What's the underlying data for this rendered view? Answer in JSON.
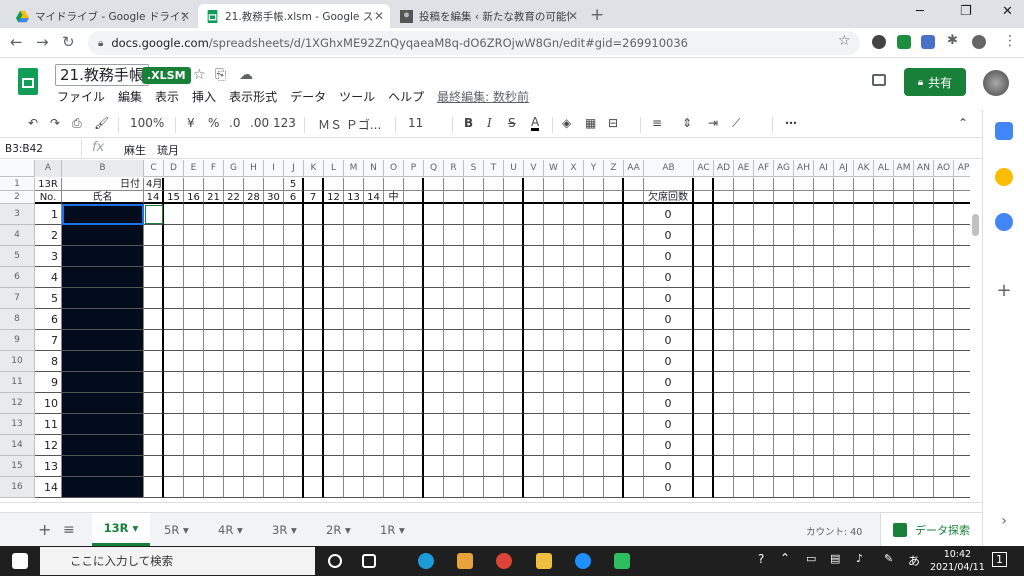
{
  "browser": {
    "tabs": [
      {
        "title": "マイドライブ - Google ドライブ",
        "icon": "drive-icon",
        "active": false
      },
      {
        "title": "21.教務手帳.xlsm - Google スプレ",
        "icon": "sheets-icon",
        "active": true
      },
      {
        "title": "投稿を編集 ‹ 新たな教育の可能性",
        "icon": "wordpress-icon",
        "active": false
      }
    ],
    "new_tab": "+",
    "url_host": "docs.google.com",
    "url_path": "/spreadsheets/d/1XGhxME92ZnQyqaeaM8q-dO6ZROjwW8Gn/edit#gid=269910036"
  },
  "app": {
    "doc_title": "21.教務手帳",
    "file_badge": ".XLSM",
    "menus": [
      "ファイル",
      "編集",
      "表示",
      "挿入",
      "表示形式",
      "データ",
      "ツール",
      "ヘルプ"
    ],
    "last_edit": "最終編集: 数秒前",
    "share_label": "共有",
    "accent": "#188038"
  },
  "toolbar": {
    "zoom": "100%",
    "currency": "¥",
    "percent": "%",
    "dec_less": ".0",
    "dec_more": ".00",
    "format": "123",
    "font": "ＭＳ Ｐゴ...",
    "font_size": "11",
    "bold": "B",
    "italic": "I",
    "strike": "S",
    "text_color": "A",
    "more": "⋯"
  },
  "formula": {
    "name_box": "B3:B42",
    "fx": "fx",
    "value": "麻生　琉月"
  },
  "sheet": {
    "columns": [
      "A",
      "B",
      "C",
      "D",
      "E",
      "F",
      "G",
      "H",
      "I",
      "J",
      "K",
      "L",
      "M",
      "N",
      "O",
      "P",
      "Q",
      "R",
      "S",
      "T",
      "U",
      "V",
      "W",
      "X",
      "Y",
      "Z",
      "AA",
      "AB",
      "AC",
      "AD",
      "AE",
      "AF",
      "AG",
      "AH",
      "AI",
      "AJ",
      "AK",
      "AL",
      "AM",
      "AN",
      "AO",
      "AP"
    ],
    "row_numbers": [
      "1",
      "2",
      "3",
      "4",
      "5",
      "6",
      "7",
      "8",
      "9",
      "10",
      "11",
      "12",
      "13",
      "14",
      "15",
      "16"
    ],
    "row1": {
      "a": "13R",
      "b": "日付",
      "c": "4月",
      "j": "5"
    },
    "row2": {
      "a": "No.",
      "b": "氏名",
      "dates": [
        "14",
        "15",
        "16",
        "21",
        "22",
        "28",
        "30",
        "6",
        "7",
        "12",
        "13",
        "14",
        "中"
      ],
      "absence_header": "欠席回数"
    },
    "student_nos": [
      "1",
      "2",
      "3",
      "4",
      "5",
      "6",
      "7",
      "8",
      "9",
      "10",
      "11",
      "12",
      "13",
      "14"
    ],
    "absence_values": [
      "0",
      "0",
      "0",
      "0",
      "0",
      "0",
      "0",
      "0",
      "0",
      "0",
      "0",
      "0",
      "0",
      "0"
    ]
  },
  "sheet_tabs": [
    "13R",
    "5R",
    "4R",
    "3R",
    "2R",
    "1R"
  ],
  "status": {
    "count": "カウント: 40",
    "explore": "データ探索"
  },
  "taskbar": {
    "search_placeholder": "ここに入力して検索",
    "time": "10:42",
    "date": "2021/04/11",
    "ime": "あ",
    "notif": "1"
  }
}
